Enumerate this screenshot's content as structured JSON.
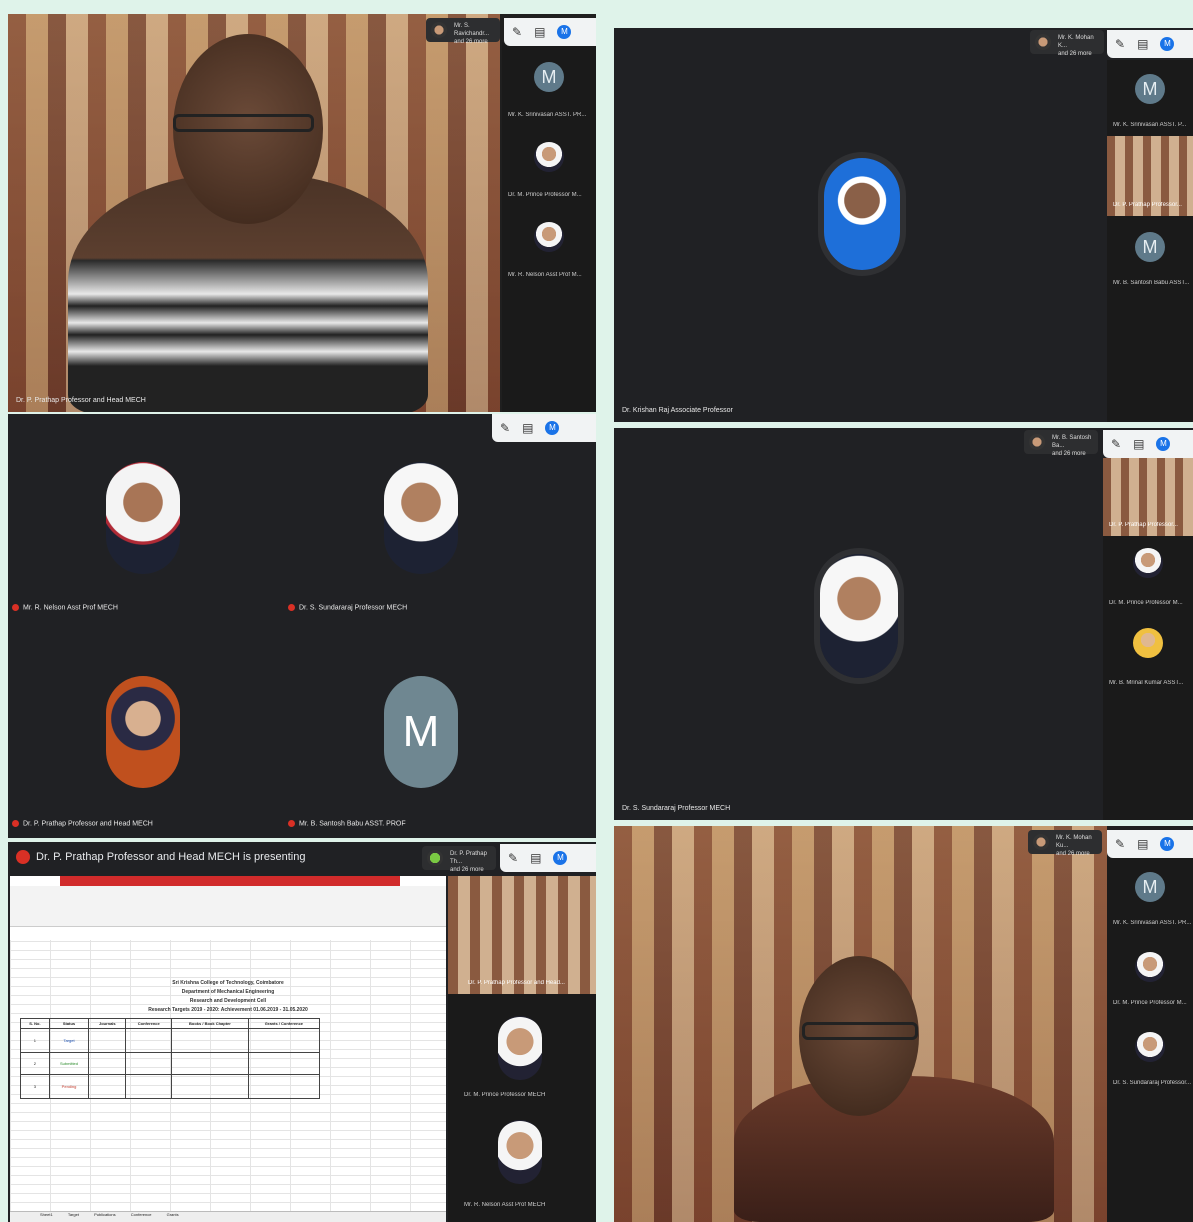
{
  "panels": {
    "p1": {
      "speaker_label": "Dr. P. Prathap Professor and Head MECH",
      "others_chip": [
        "Mr. S. Ravichandr...",
        "and 26 more"
      ],
      "sidebar": [
        {
          "label": "Mr. K. Srinivasan ASST. PR...",
          "avatar_letter": "M"
        },
        {
          "label": "Dr. M. Prince Professor M..."
        },
        {
          "label": "Mr. R. Nelson Asst Prof M..."
        }
      ],
      "toolbar_avatar": "M"
    },
    "p2": {
      "speaker_label": "Dr. Krishan Raj Associate Professor",
      "others_chip": [
        "Mr. K. Mohan K...",
        "and 26 more"
      ],
      "sidebar": [
        {
          "label": "Mr. K. Srinivasan ASST. P...",
          "avatar_letter": "M"
        },
        {
          "label": "Dr. P. Prathap Professor..."
        },
        {
          "label": "Mr. B. Santosh Babu ASST...",
          "avatar_letter": "M"
        }
      ],
      "toolbar_avatar": "M"
    },
    "p3": {
      "tiles": [
        {
          "label": "Mr. R. Nelson Asst Prof MECH"
        },
        {
          "label": "Dr. S. Sundararaj Professor MECH"
        },
        {
          "label": "Dr. P. Prathap Professor and Head MECH"
        },
        {
          "label": "Mr. B. Santosh Babu ASST. PROF",
          "avatar_letter": "M"
        }
      ],
      "toolbar_avatar": "M"
    },
    "p4": {
      "speaker_label": "Dr. S. Sundararaj Professor MECH",
      "others_chip": [
        "Mr. B. Santosh Ba...",
        "and 26 more"
      ],
      "sidebar": [
        {
          "label": "Dr. P. Prathap Professor..."
        },
        {
          "label": "Dr. M. Prince Professor M..."
        },
        {
          "label": "Mr. B. Mrinal Kumar ASST..."
        }
      ],
      "toolbar_avatar": "M"
    },
    "p5": {
      "presenting_text": "Dr. P. Prathap Professor and Head MECH is presenting",
      "others_chip": [
        "Dr. P. Prathap Th...",
        "and 26 more"
      ],
      "sidebar": [
        {
          "label": "Dr. P. Prathap Professor and Head..."
        },
        {
          "label": "Dr. M. Prince Professor MECH"
        },
        {
          "label": "Mr. R. Nelson Asst Prof MECH"
        }
      ],
      "sheet": {
        "title_lines": [
          "Sri Krishna College of Technology, Coimbatore",
          "Department of Mechanical Engineering",
          "Research and Development Cell",
          "Research Targets 2019 - 2020: Achievement 01.06.2019 - 31.05.2020"
        ],
        "headers": [
          "S. No.",
          "Status",
          "Journals",
          "Conference",
          "Books / Book Chapter",
          "Grants / Conference"
        ],
        "rows": [
          [
            "1",
            "Target"
          ],
          [
            "2",
            "Submitted"
          ],
          [
            "3",
            "Pending"
          ]
        ],
        "tabs": [
          "Sheet1",
          "Target",
          "Publications",
          "Conference",
          "Grants"
        ]
      },
      "toolbar_avatar": "M"
    },
    "p6": {
      "others_chip": [
        "Mr. K. Mohan Ku...",
        "and 26 more"
      ],
      "sidebar": [
        {
          "label": "Mr. K. Srinivasan ASST. PR...",
          "avatar_letter": "M"
        },
        {
          "label": "Dr. M. Prince Professor M..."
        },
        {
          "label": "Dr. S. Sundararaj Professor..."
        }
      ],
      "toolbar_avatar": "M"
    }
  },
  "toolbar_icons": [
    "pin-icon",
    "chat-icon",
    "people-icon"
  ]
}
